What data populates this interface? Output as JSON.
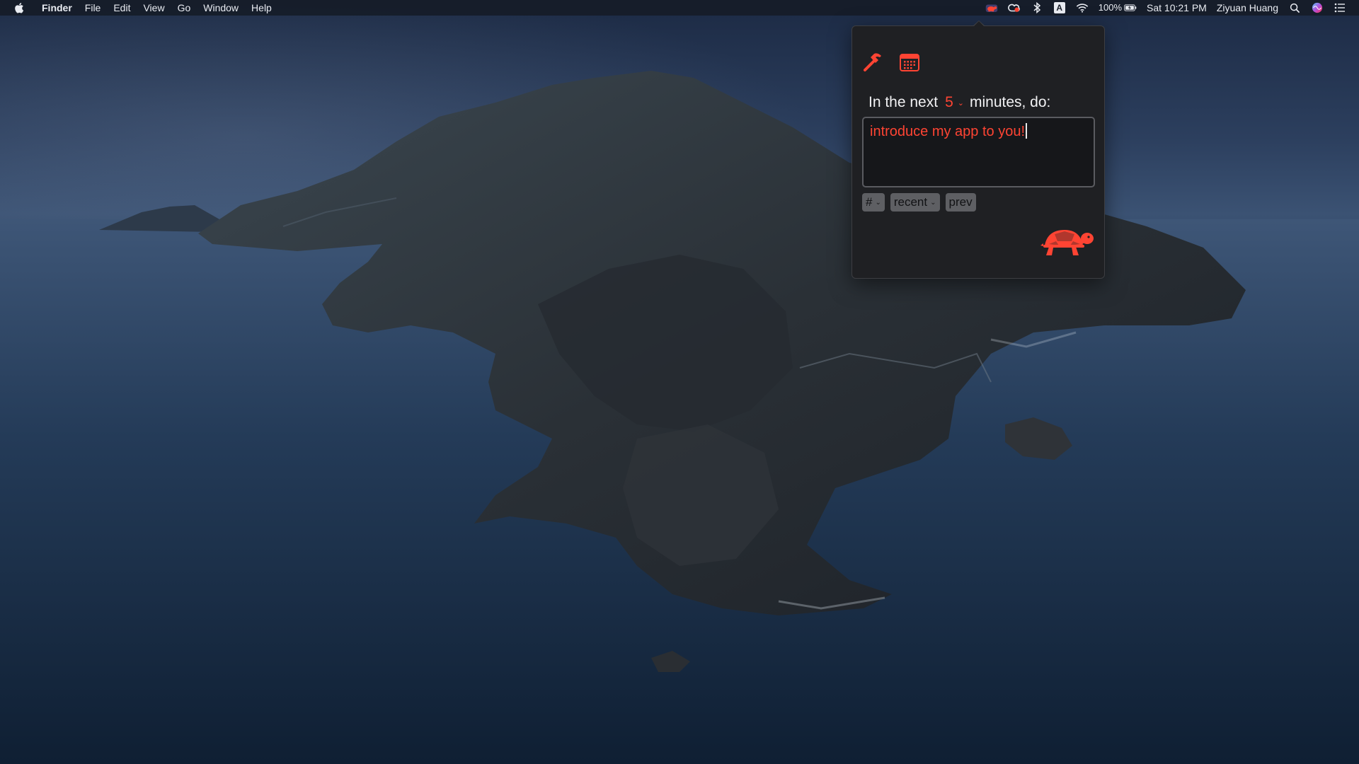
{
  "menubar": {
    "apple_icon": "apple-logo-icon",
    "app_name": "Finder",
    "menus": [
      "File",
      "Edit",
      "View",
      "Go",
      "Window",
      "Help"
    ],
    "tray": {
      "icons": [
        "turtle-menubar-icon",
        "creative-cloud-icon",
        "bluetooth-icon",
        "input-source-icon",
        "wifi-icon",
        "battery-icon",
        "search-icon",
        "siri-icon",
        "notification-center-icon"
      ],
      "input_source": "A",
      "battery_percent": "100%",
      "clock": "Sat 10:21 PM",
      "user": "Ziyuan Huang"
    }
  },
  "popover": {
    "toolbar": {
      "icons": [
        "hammer-icon",
        "calendar-icon"
      ]
    },
    "prompt_prefix": "In the next",
    "minutes_value": "5",
    "prompt_suffix": "minutes, do:",
    "task_text": "introduce my app to you!",
    "chips": {
      "tag": "#",
      "recent": "recent",
      "prev": "prev"
    },
    "accent_color": "#ff4433",
    "start_icon": "turtle-icon"
  }
}
